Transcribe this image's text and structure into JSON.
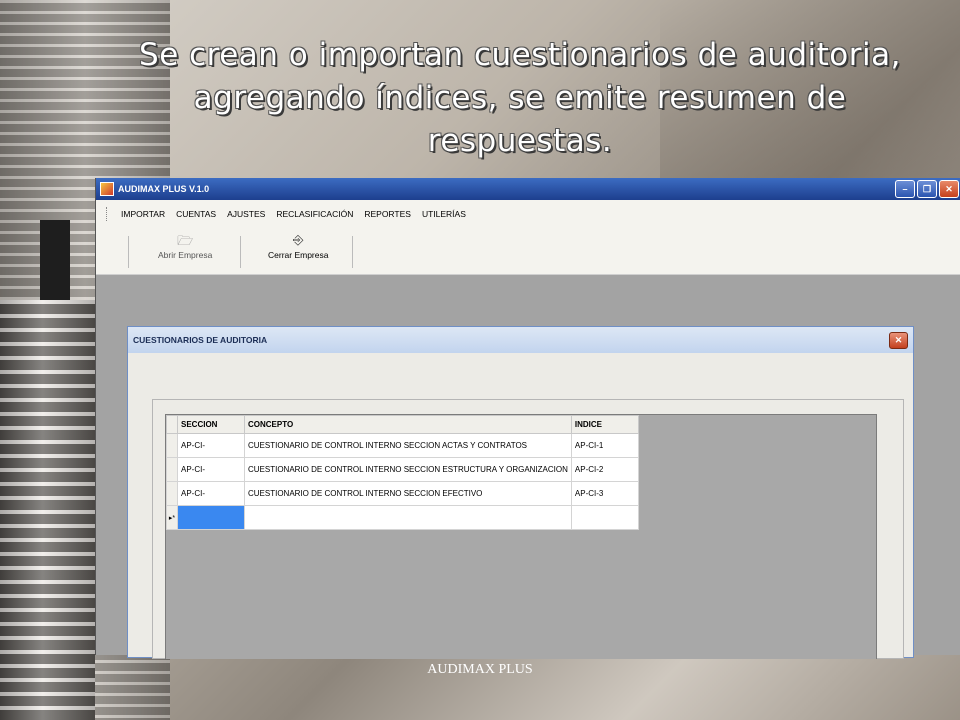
{
  "slide": {
    "title": "Se crean o importan cuestionarios de auditoria, agregando índices, se emite resumen de respuestas.",
    "footer": "AUDIMAX PLUS"
  },
  "app": {
    "title": "AUDIMAX PLUS V.1.0",
    "menu": [
      "IMPORTAR",
      "CUENTAS",
      "AJUSTES",
      "RECLASIFICACIÓN",
      "REPORTES",
      "UTILERÍAS"
    ],
    "toolbar": {
      "open_label": "Abrir Empresa",
      "close_label": "Cerrar Empresa"
    }
  },
  "dialog": {
    "title": "CUESTIONARIOS DE AUDITORIA",
    "columns": [
      "SECCION",
      "CONCEPTO",
      "INDICE"
    ],
    "rows": [
      {
        "seccion": "AP-CI-",
        "concepto": "CUESTIONARIO DE CONTROL INTERNO SECCION ACTAS Y CONTRATOS",
        "indice": "AP-CI-1"
      },
      {
        "seccion": "AP-CI-",
        "concepto": "CUESTIONARIO DE CONTROL INTERNO SECCION ESTRUCTURA Y ORGANIZACION",
        "indice": "AP-CI-2"
      },
      {
        "seccion": "AP-CI-",
        "concepto": "CUESTIONARIO DE CONTROL INTERNO SECCION EFECTIVO",
        "indice": "AP-CI-3"
      }
    ],
    "new_row_marker": "▸*"
  }
}
